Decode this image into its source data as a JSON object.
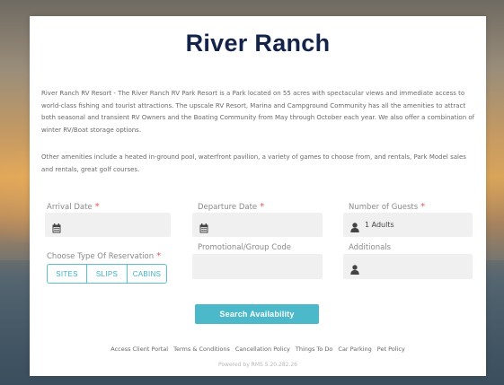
{
  "page": {
    "title": "River Ranch",
    "description_1": "River Ranch RV Resort - The River Ranch RV Park Resort is a Park located on 55 acres with spectacular views and immediate access to world-class fishing and tourist attractions. The upscale RV Resort, Marina and Campground Community has all the amenities to attract both seasonal and transient RV Owners and the Boating Community from May through October each year. We also offer a combination of winter RV/Boat storage options.",
    "description_2": "Other amenities include a heated in-ground pool, waterfront pavilion, a variety of games to choose from, and rentals, Park Model sales and rentals, great golf courses."
  },
  "form": {
    "arrival_label": "Arrival Date",
    "departure_label": "Departure Date",
    "guests_label": "Number of Guests",
    "guests_value": "1 Adults",
    "reservation_type_label": "Choose Type Of Reservation",
    "required_mark": "*",
    "reservation_types": [
      "SITES",
      "SLIPS",
      "CABINS"
    ],
    "promo_label": "Promotional/Group Code",
    "additionals_label": "Additionals",
    "search_button": "Search Availability"
  },
  "footer": {
    "links": [
      "Access Client Portal",
      "Terms & Conditions",
      "Cancellation Policy",
      "Things To Do",
      "Car Parking",
      "Pet Policy"
    ],
    "powered_by": "Powered by RMS 5.20.282.26"
  },
  "icons": {
    "calendar": "calendar-icon",
    "person": "person-icon"
  },
  "colors": {
    "title": "#14234a",
    "accent": "#4bb9c9",
    "required": "#e05a4f"
  }
}
